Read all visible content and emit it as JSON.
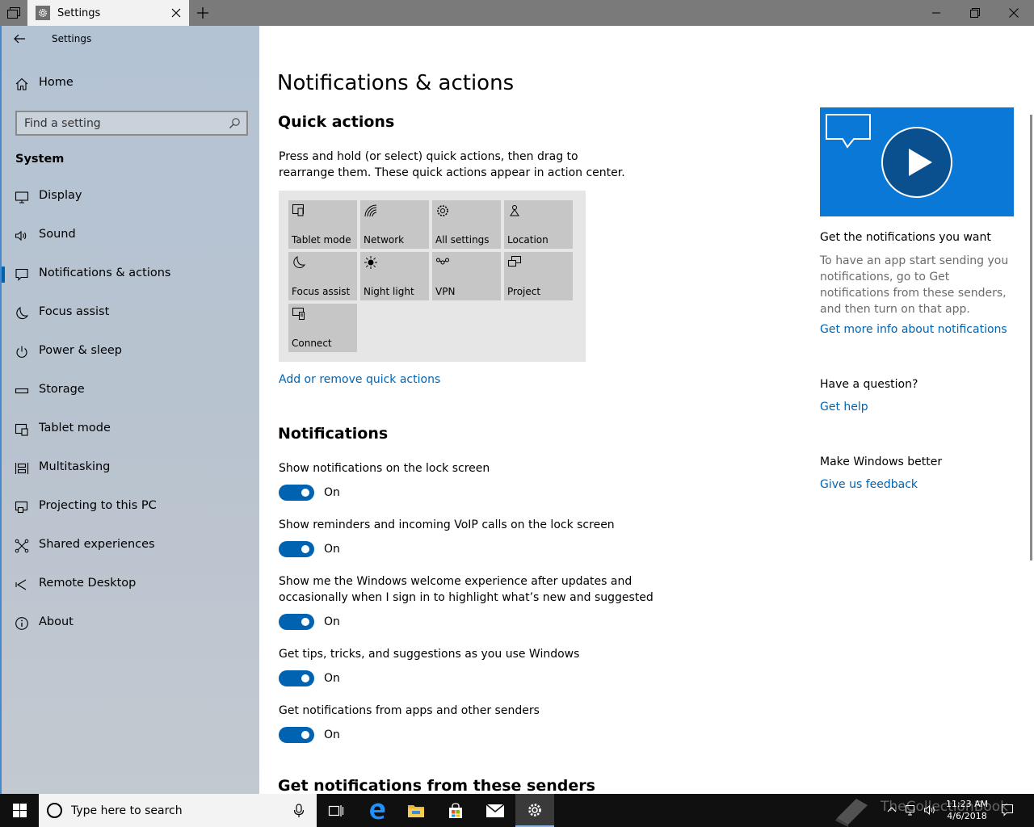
{
  "window": {
    "tab_title": "Settings",
    "app_title": "Settings"
  },
  "sidebar": {
    "home": "Home",
    "search_placeholder": "Find a setting",
    "section": "System",
    "items": [
      {
        "label": "Display",
        "icon": "monitor-icon"
      },
      {
        "label": "Sound",
        "icon": "speaker-icon"
      },
      {
        "label": "Notifications & actions",
        "icon": "notification-icon",
        "active": true
      },
      {
        "label": "Focus assist",
        "icon": "moon-icon"
      },
      {
        "label": "Power & sleep",
        "icon": "power-icon"
      },
      {
        "label": "Storage",
        "icon": "storage-icon"
      },
      {
        "label": "Tablet mode",
        "icon": "tablet-mode-icon"
      },
      {
        "label": "Multitasking",
        "icon": "multitasking-icon"
      },
      {
        "label": "Projecting to this PC",
        "icon": "projecting-icon"
      },
      {
        "label": "Shared experiences",
        "icon": "shared-experiences-icon"
      },
      {
        "label": "Remote Desktop",
        "icon": "remote-desktop-icon"
      },
      {
        "label": "About",
        "icon": "info-icon"
      }
    ]
  },
  "main": {
    "title": "Notifications & actions",
    "quick_actions": {
      "title": "Quick actions",
      "description": "Press and hold (or select) quick actions, then drag to rearrange them. These quick actions appear in action center.",
      "tiles": [
        {
          "label": "Tablet mode",
          "icon": "tablet-mode-icon"
        },
        {
          "label": "Network",
          "icon": "network-icon"
        },
        {
          "label": "All settings",
          "icon": "gear-icon"
        },
        {
          "label": "Location",
          "icon": "location-icon"
        },
        {
          "label": "Focus assist",
          "icon": "moon-icon"
        },
        {
          "label": "Night light",
          "icon": "sun-icon"
        },
        {
          "label": "VPN",
          "icon": "vpn-icon"
        },
        {
          "label": "Project",
          "icon": "project-icon"
        },
        {
          "label": "Connect",
          "icon": "connect-icon"
        }
      ],
      "add_remove_link": "Add or remove quick actions"
    },
    "notifications": {
      "title": "Notifications",
      "settings": [
        {
          "label": "Show notifications on the lock screen",
          "state": "On"
        },
        {
          "label": "Show reminders and incoming VoIP calls on the lock screen",
          "state": "On"
        },
        {
          "label_line1": "Show me the Windows welcome experience after updates and",
          "label_line2": "occasionally when I sign in to highlight what’s new and suggested",
          "state": "On"
        },
        {
          "label": "Get tips, tricks, and suggestions as you use Windows",
          "state": "On"
        },
        {
          "label": "Get notifications from apps and other senders",
          "state": "On"
        }
      ]
    },
    "senders_title": "Get notifications from these senders"
  },
  "right_column": {
    "video_icons": [
      "chat-bubble-icon",
      "play-icon"
    ],
    "tip_title": "Get the notifications you want",
    "tip_text": "To have an app start sending you notifications, go to Get notifications from these senders, and then turn on that app.",
    "tip_link": "Get more info about notifications",
    "question_title": "Have a question?",
    "question_link": "Get help",
    "feedback_title": "Make Windows better",
    "feedback_link": "Give us feedback"
  },
  "taskbar": {
    "search_placeholder": "Type here to search",
    "time": "11:23 AM",
    "date": "4/6/2018",
    "watermark": "TheCollectionBook"
  },
  "colors": {
    "accent": "#0063b1",
    "video_bg": "#0a78d7",
    "tile_bg": "#c6c6c6",
    "taskbar": "#101010"
  }
}
